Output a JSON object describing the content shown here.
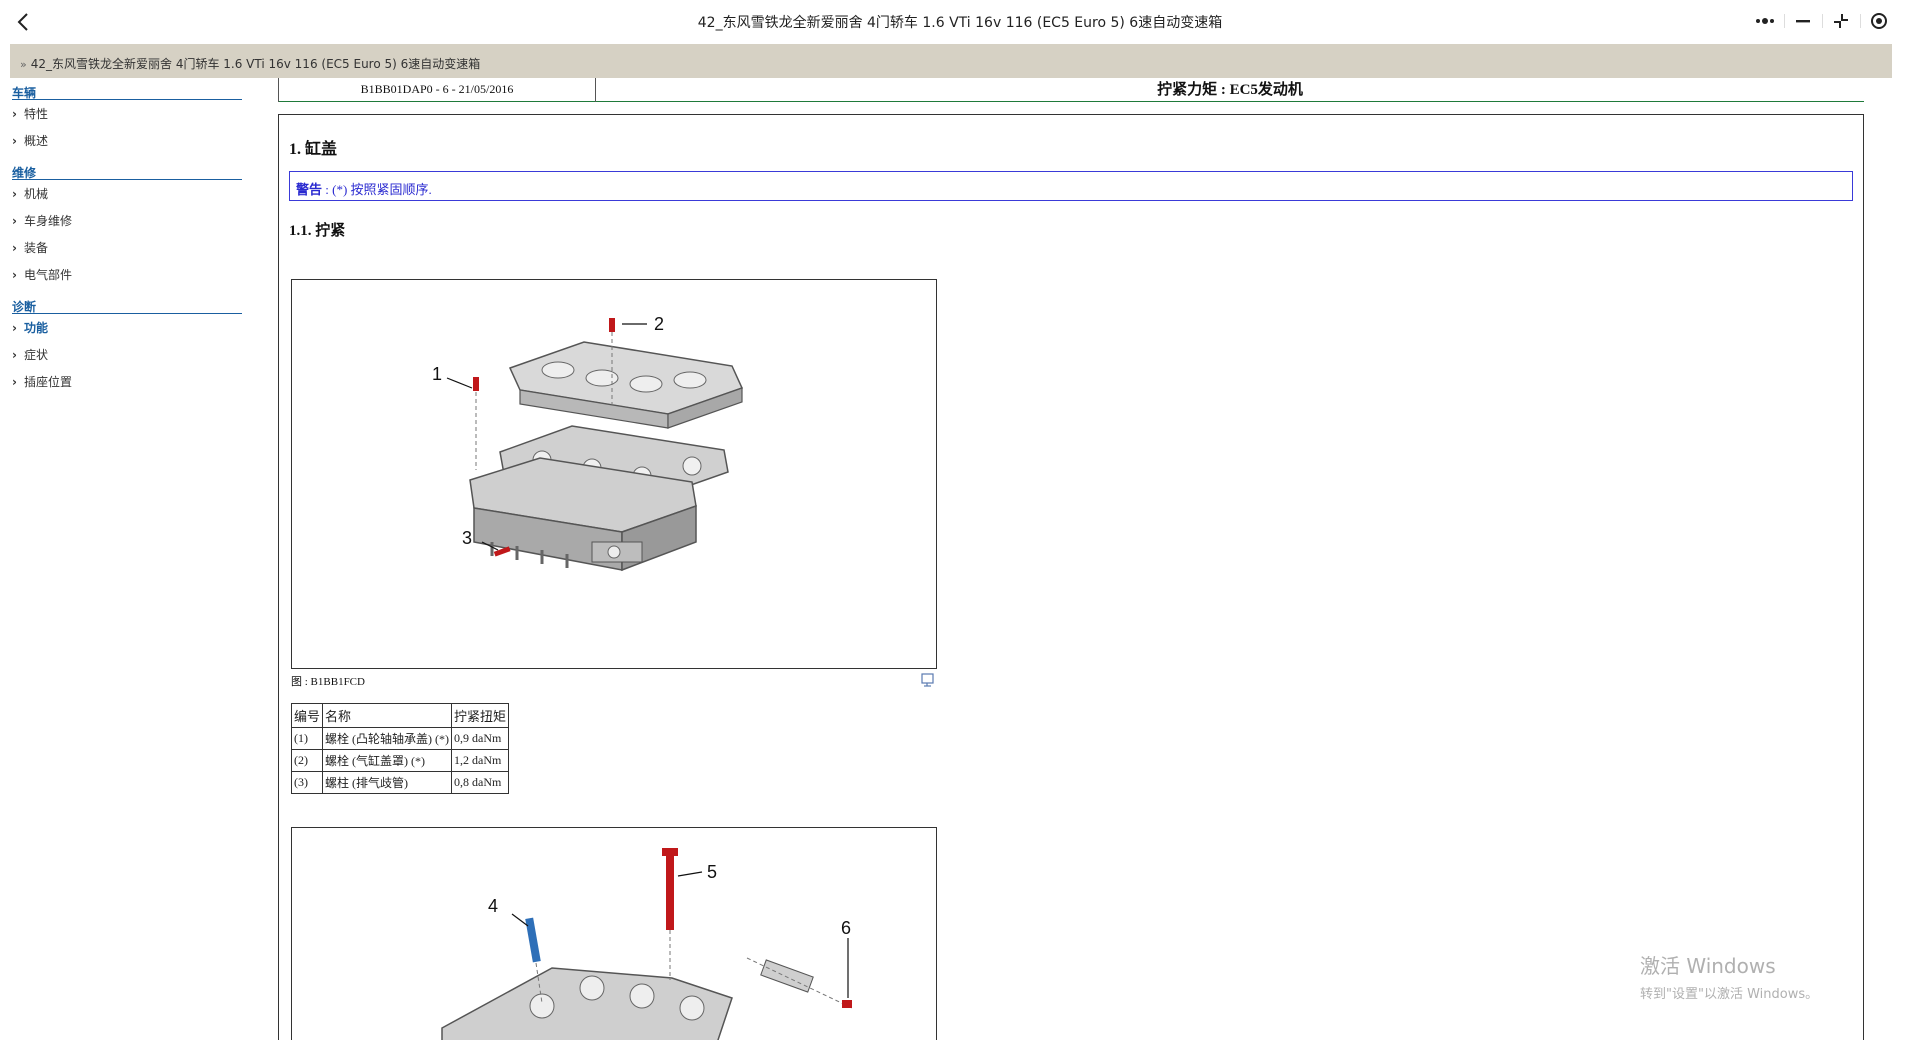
{
  "titlebar": {
    "title": "42_东风雪铁龙全新爱丽舍 4门轿车 1.6 VTi 16v 116 (EC5 Euro 5) 6速自动变速箱"
  },
  "breadcrumb": {
    "text": "42_东风雪铁龙全新爱丽舍 4门轿车 1.6 VTi 16v 116 (EC5 Euro 5) 6速自动变速箱"
  },
  "sidebar": {
    "sections": [
      {
        "heading": "车辆",
        "items": [
          {
            "label": "特性"
          },
          {
            "label": "概述"
          }
        ]
      },
      {
        "heading": "维修",
        "items": [
          {
            "label": "机械"
          },
          {
            "label": "车身维修"
          },
          {
            "label": "装备"
          },
          {
            "label": "电气部件"
          }
        ]
      },
      {
        "heading": "诊断",
        "items": [
          {
            "label": "功能"
          },
          {
            "label": "症状"
          },
          {
            "label": "插座位置"
          }
        ]
      }
    ]
  },
  "doc": {
    "id": "B1BB01DAP0 - 6 - 21/05/2016",
    "title": "拧紧力矩 : EC5发动机",
    "section_title": "1. 缸盖",
    "warning_label": "警告",
    "warning_text": " : (*) 按照紧固顺序.",
    "subsection_title": "1.1. 拧紧",
    "figure1_caption": "图 : B1BB1FCD",
    "figure1_callouts": [
      "1",
      "2",
      "3"
    ],
    "figure2_callouts": [
      "4",
      "5",
      "6"
    ]
  },
  "torque_table": {
    "headers": [
      "编号",
      "名称",
      "拧紧扭矩"
    ],
    "rows": [
      [
        "(1)",
        "螺栓 (凸轮轴轴承盖) (*)",
        "0,9 daNm"
      ],
      [
        "(2)",
        "螺栓 (气缸盖罩) (*)",
        "1,2 daNm"
      ],
      [
        "(3)",
        "螺柱 (排气歧管)",
        "0,8 daNm"
      ]
    ]
  },
  "watermark": {
    "line1": "激活 Windows",
    "line2": "转到\"设置\"以激活 Windows。"
  },
  "icons": {
    "back": "back-arrow-icon",
    "more": "more-icon",
    "minimize": "minimize-icon",
    "restore": "restore-icon",
    "close": "target-close-icon",
    "figure_action": "figure-zoom-icon"
  }
}
